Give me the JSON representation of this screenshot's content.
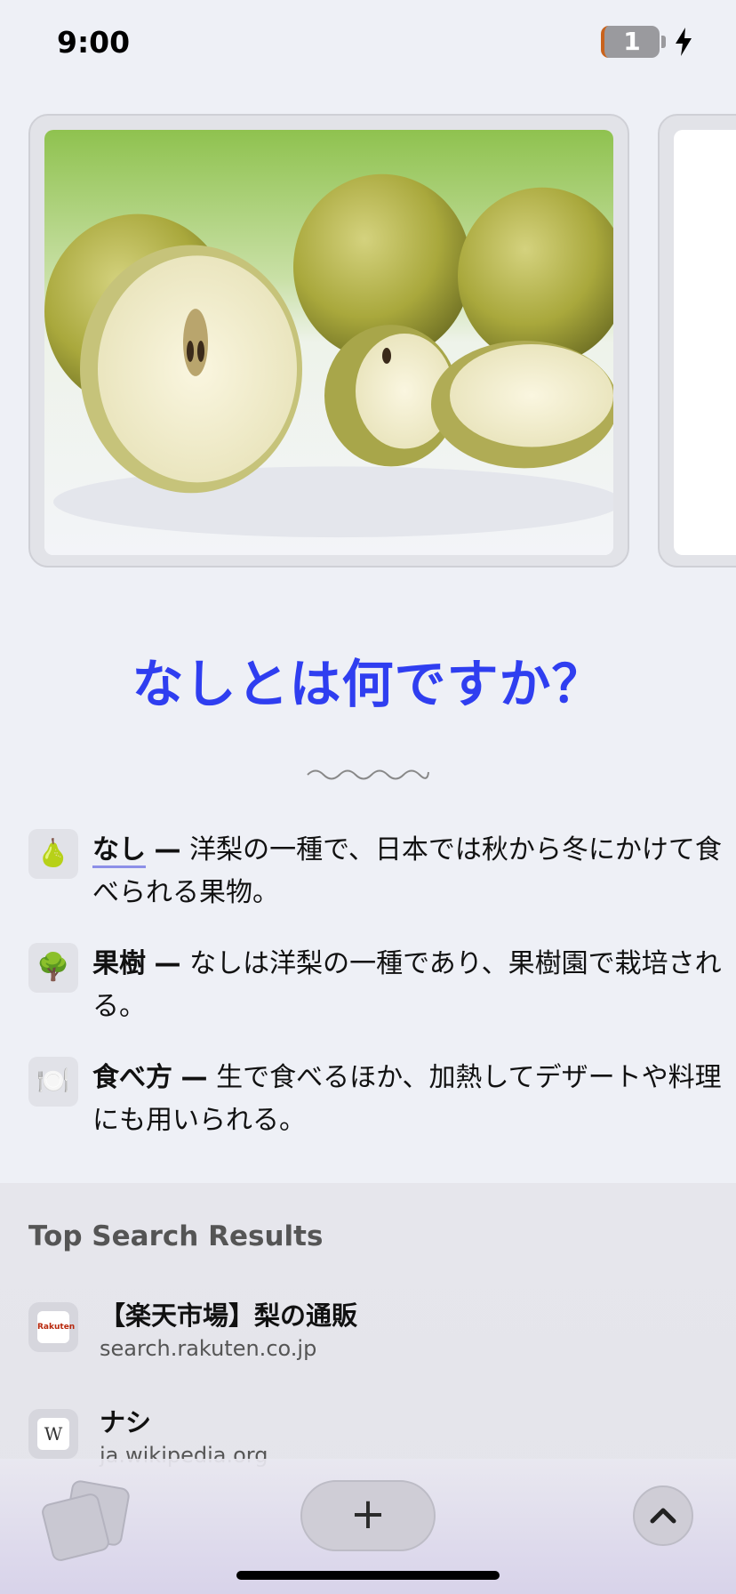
{
  "status_bar": {
    "time": "9:00",
    "battery_level": "1",
    "charging_icon": "bolt-icon"
  },
  "carousel": {
    "images": [
      {
        "subject": "nashi pears",
        "icon": "pear-photo"
      },
      {
        "subject": "partial next image",
        "icon": "image-placeholder"
      }
    ]
  },
  "question": "なしとは何ですか？",
  "facts": [
    {
      "icon": "🍐",
      "term": "なし",
      "dash": "—",
      "text": "洋梨の一種で、日本では秋から冬にかけて食べられる果物。"
    },
    {
      "icon": "🌳",
      "term": "果樹",
      "dash": "—",
      "text": "なしは洋梨の一種であり、果樹園で栽培される。"
    },
    {
      "icon": "🍽️",
      "term": "食べ方",
      "dash": "—",
      "text": "生で食べるほか、加熱してデザートや料理にも用いられる。"
    }
  ],
  "search_results": {
    "heading": "Top Search Results",
    "items": [
      {
        "title": "【楽天市場】梨の通販",
        "domain": "search.rakuten.co.jp",
        "favicon_text": "Rakuten"
      },
      {
        "title": "ナシ",
        "domain": "ja.wikipedia.org",
        "favicon_text": "W"
      }
    ]
  },
  "toolbar": {
    "new_tab_label": "+",
    "tabs_icon": "tabs-icon",
    "scroll_up_icon": "chevron-up-icon"
  },
  "colors": {
    "accent": "#2f3ef0",
    "background": "#eef0f6",
    "link_underline": "#8d90e8"
  }
}
